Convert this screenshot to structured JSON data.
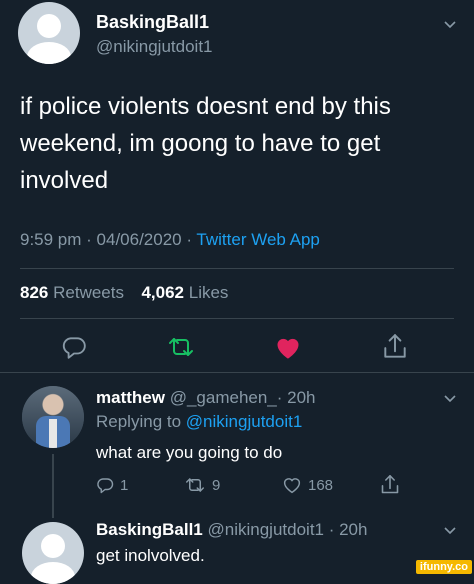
{
  "tweet": {
    "display_name": "BaskingBall1",
    "handle": "@nikingjutdoit1",
    "text": "if police violents doesnt end by this weekend, im  goong to have to get involved",
    "time": "9:59 pm · 04/06/2020 · ",
    "source": "Twitter Web App",
    "retweets": "826",
    "retweets_label": "Retweets",
    "likes": "4,062",
    "likes_label": "Likes"
  },
  "reply1": {
    "display_name": "matthew",
    "handle_time": "@_gamehen_· 20h",
    "replying_prefix": "Replying to ",
    "replying_handle": "@nikingjutdoit1",
    "text": "what are you going to do",
    "reply_count": "1",
    "retweet_count": "9",
    "like_count": "168"
  },
  "reply2": {
    "display_name": "BaskingBall1",
    "handle_time": "@nikingjutdoit1 · 20h",
    "text": "get inolvolved."
  },
  "watermark": "ifunny.co",
  "colors": {
    "background": "#15202b",
    "muted": "#8899a6",
    "link": "#1da1f2",
    "retweet_green": "#17bf63",
    "like_red": "#e0245e"
  },
  "icons": [
    "chevron-down-icon",
    "reply-icon",
    "retweet-icon",
    "heart-icon",
    "share-icon"
  ]
}
